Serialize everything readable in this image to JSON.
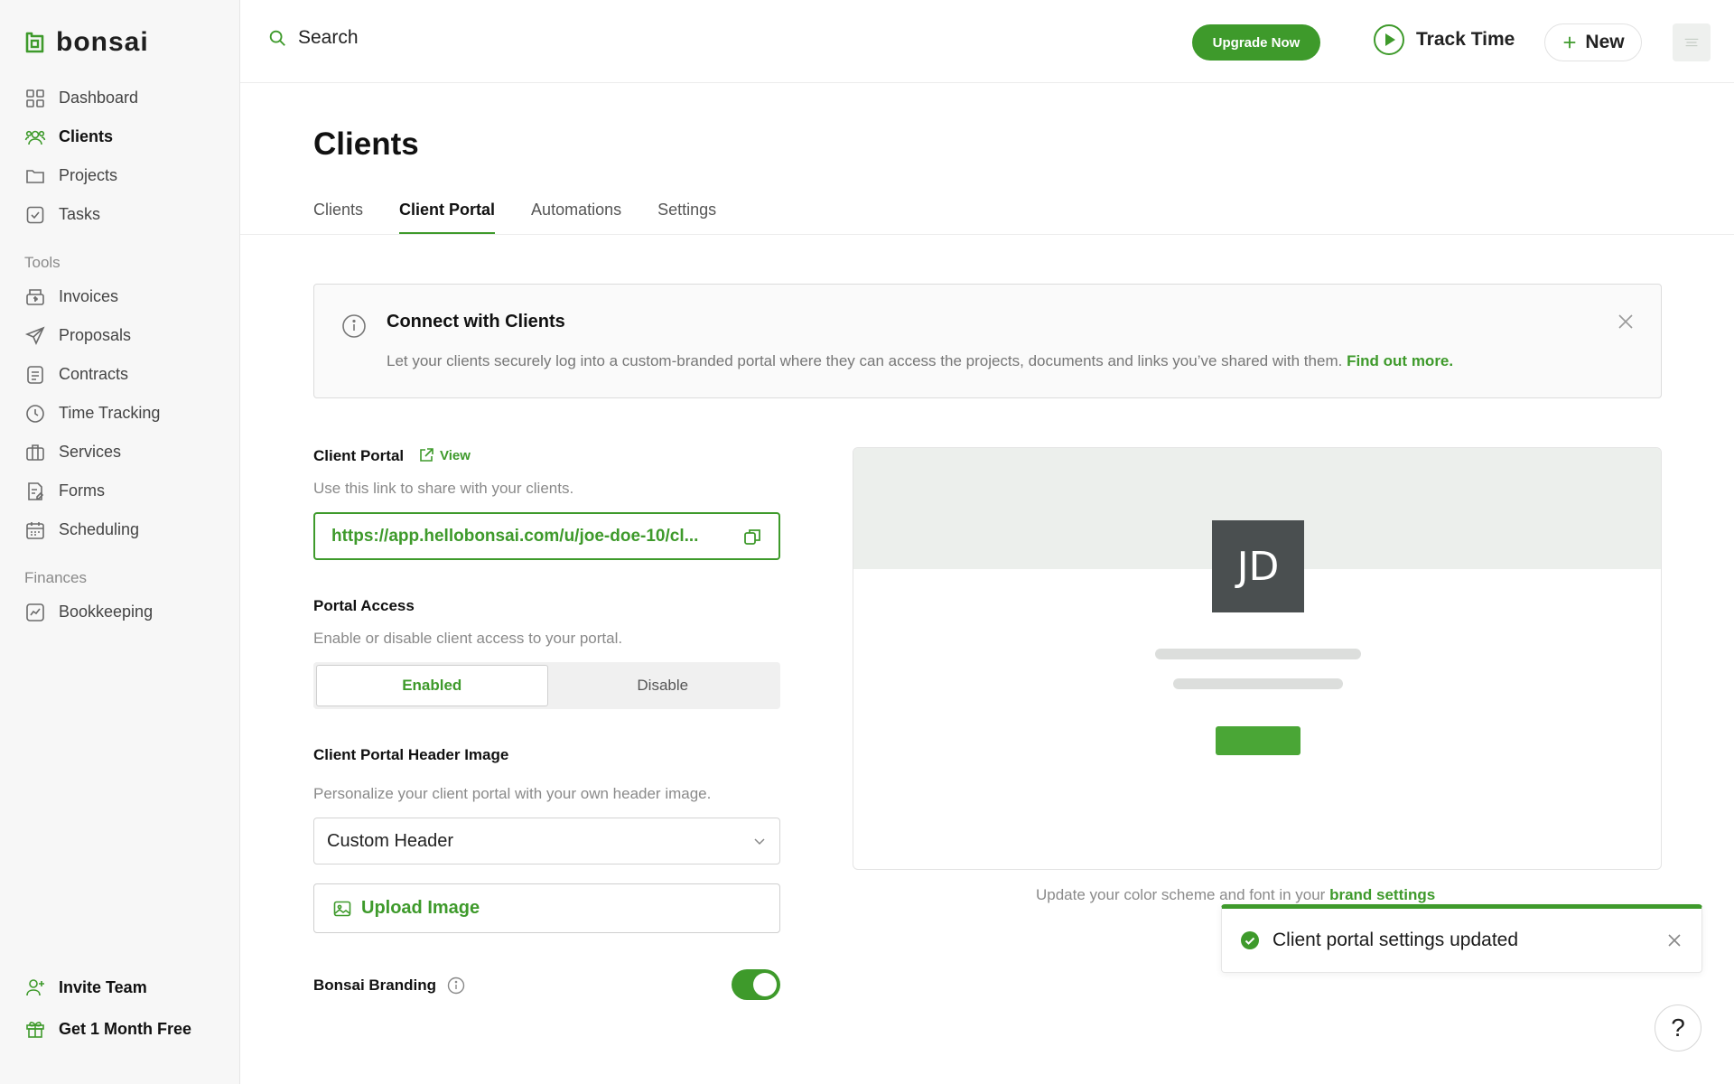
{
  "app": {
    "logo_text": "bonsai"
  },
  "colors": {
    "accent": "#3e9a2b",
    "sidebar_bg": "#f7f7f7",
    "avatar_bg": "#4a4f50"
  },
  "sidebar": {
    "main": [
      {
        "label": "Dashboard",
        "icon": "grid-icon"
      },
      {
        "label": "Clients",
        "icon": "users-icon",
        "active": true
      },
      {
        "label": "Projects",
        "icon": "folder-icon"
      },
      {
        "label": "Tasks",
        "icon": "checkbox-icon"
      }
    ],
    "tools_title": "Tools",
    "tools": [
      {
        "label": "Invoices",
        "icon": "invoice-icon"
      },
      {
        "label": "Proposals",
        "icon": "send-icon"
      },
      {
        "label": "Contracts",
        "icon": "document-icon"
      },
      {
        "label": "Time Tracking",
        "icon": "clock-icon"
      },
      {
        "label": "Services",
        "icon": "briefcase-icon"
      },
      {
        "label": "Forms",
        "icon": "form-icon"
      },
      {
        "label": "Scheduling",
        "icon": "calendar-icon"
      }
    ],
    "finances_title": "Finances",
    "finances": [
      {
        "label": "Bookkeeping",
        "icon": "chart-icon"
      }
    ],
    "bottom": [
      {
        "label": "Invite Team",
        "icon": "user-plus-icon"
      },
      {
        "label": "Get 1 Month Free",
        "icon": "gift-icon"
      }
    ]
  },
  "topbar": {
    "search_label": "Search",
    "upgrade_label": "Upgrade Now",
    "track_time_label": "Track Time",
    "new_label": "New"
  },
  "page": {
    "title": "Clients",
    "tabs": [
      "Clients",
      "Client Portal",
      "Automations",
      "Settings"
    ],
    "active_tab": "Client Portal"
  },
  "info": {
    "title": "Connect with Clients",
    "text": "Let your clients securely log into a custom-branded portal where they can access the projects, documents and links you’ve shared with them. ",
    "link": "Find out more."
  },
  "portal": {
    "label": "Client Portal",
    "view_label": "View",
    "hint": "Use this link to share with your clients.",
    "url": "https://app.hellobonsai.com/u/joe-doe-10/cl..."
  },
  "access": {
    "label": "Portal Access",
    "hint": "Enable or disable client access to your portal.",
    "enabled_label": "Enabled",
    "disable_label": "Disable",
    "selected": "Enabled"
  },
  "header_image": {
    "label": "Client Portal Header Image",
    "hint": "Personalize your client portal with your own header image.",
    "selected_option": "Custom Header",
    "upload_label": "Upload Image"
  },
  "branding": {
    "label": "Bonsai Branding",
    "enabled": true
  },
  "preview": {
    "avatar_initials": "JD",
    "note_text": "Update your color scheme and font in your ",
    "note_link": "brand settings"
  },
  "toast": {
    "message": "Client portal settings updated"
  },
  "help": {
    "label": "?"
  }
}
